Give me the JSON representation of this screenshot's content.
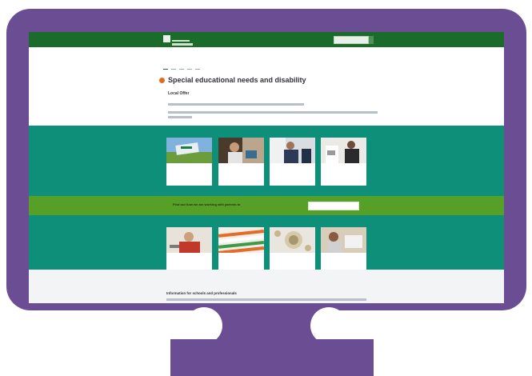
{
  "header": {
    "logo_text": "",
    "search_placeholder": ""
  },
  "nav": {
    "breadcrumb": "",
    "breadcrumb2": "",
    "signin": "",
    "tabs": [
      "",
      "",
      "",
      "",
      ""
    ]
  },
  "page": {
    "title": "Special educational needs and disability",
    "subtitle": "Local Offer"
  },
  "cards_top": [
    {
      "label": ""
    },
    {
      "label": ""
    },
    {
      "label": ""
    },
    {
      "label": ""
    }
  ],
  "band": {
    "text": "Find out how we are working with parents to",
    "button": ""
  },
  "cards_bottom": [
    {
      "label": ""
    },
    {
      "label": ""
    },
    {
      "label": ""
    },
    {
      "label": ""
    }
  ],
  "info": {
    "title": "Information for schools and professionals"
  },
  "colors": {
    "frame": "#6b4d94",
    "topbar": "#1b6b2a",
    "teal": "#0e8f7a",
    "band": "#57a027",
    "accent_dot": "#e66a1d"
  }
}
